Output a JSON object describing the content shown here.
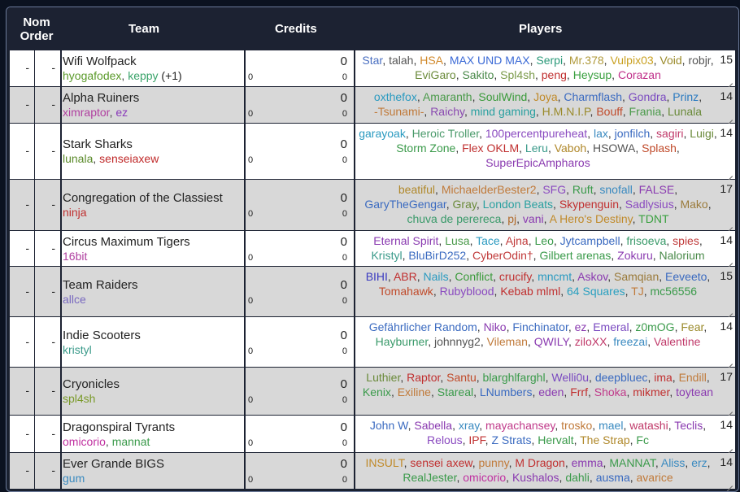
{
  "headers": {
    "nom_order": "Nom Order",
    "team": "Team",
    "credits": "Credits",
    "players": "Players"
  },
  "colors": {
    "header_bg": "#1c2232",
    "row_light": "#ffffff",
    "row_dark": "#d8d8d8"
  },
  "rows": [
    {
      "nom": "-",
      "order": "-",
      "team": "Wifi Wolfpack",
      "members": [
        {
          "t": "hyogafodex",
          "c": "#5a9a2a"
        },
        {
          "t": ", ",
          "c": "#444"
        },
        {
          "t": "keppy",
          "c": "#3aa36a"
        },
        {
          "t": " (+1)",
          "c": "#222"
        }
      ],
      "credits": "0",
      "credits_left": "0",
      "credits_right": "0",
      "count": "15",
      "players": [
        {
          "t": "Star",
          "c": "#4a6fc1"
        },
        {
          "t": "talah",
          "c": "#555"
        },
        {
          "t": "HSA",
          "c": "#d0882a"
        },
        {
          "t": "MAX UND MAX",
          "c": "#3b6ad6"
        },
        {
          "t": "Serpi",
          "c": "#2c9a7a"
        },
        {
          "t": "Mr.378",
          "c": "#b09a3c"
        },
        {
          "t": "Vulpix03",
          "c": "#c9a020"
        },
        {
          "t": "Void",
          "c": "#9a8a2a"
        },
        {
          "t": "robjr",
          "c": "#555"
        },
        {
          "t": "EviGaro",
          "c": "#6a8a3a"
        },
        {
          "t": "Sakito",
          "c": "#4a8a4a"
        },
        {
          "t": "Spl4sh",
          "c": "#7a9a4a"
        },
        {
          "t": "peng",
          "c": "#c03030"
        },
        {
          "t": "Heysup",
          "c": "#3aa040"
        },
        {
          "t": "Corazan",
          "c": "#c0308a"
        }
      ]
    },
    {
      "nom": "-",
      "order": "-",
      "team": "Alpha Ruiners",
      "members": [
        {
          "t": "ximraptor",
          "c": "#b040a0"
        },
        {
          "t": ", ",
          "c": "#444"
        },
        {
          "t": "ez",
          "c": "#8a3aba"
        }
      ],
      "credits": "0",
      "credits_left": "0",
      "credits_right": "0",
      "count": "14",
      "players": [
        {
          "t": "oxthefox",
          "c": "#2a9ac0"
        },
        {
          "t": "Amaranth",
          "c": "#4a9a4a"
        },
        {
          "t": "SoulWind",
          "c": "#3a9a3a"
        },
        {
          "t": "Joya",
          "c": "#c08a2a"
        },
        {
          "t": "Charmflash",
          "c": "#3a6ac0"
        },
        {
          "t": "Gondra",
          "c": "#7a4ac0"
        },
        {
          "t": "Prinz",
          "c": "#2a7ac0"
        },
        {
          "t": "-Tsunami-",
          "c": "#c07a3a"
        },
        {
          "t": "Raichy",
          "c": "#8a4ab0"
        },
        {
          "t": "mind gaming",
          "c": "#2aa0a0"
        },
        {
          "t": "H.M.N.I.P",
          "c": "#9a8a2a"
        },
        {
          "t": "Bouff",
          "c": "#c04a2a"
        },
        {
          "t": "Frania",
          "c": "#4a9a4a"
        },
        {
          "t": "Lunala",
          "c": "#6a8a3a"
        }
      ]
    },
    {
      "nom": "-",
      "order": "-",
      "team": "Stark Sharks",
      "members": [
        {
          "t": "lunala",
          "c": "#5a8a2a"
        },
        {
          "t": ", ",
          "c": "#444"
        },
        {
          "t": "senseiaxew",
          "c": "#c02a2a"
        }
      ],
      "credits": "0",
      "credits_left": "0",
      "credits_right": "0",
      "count": "14",
      "players": [
        {
          "t": "garayoak",
          "c": "#2a9ac0"
        },
        {
          "t": "Heroic Troller",
          "c": "#4a9a6a"
        },
        {
          "t": "100percentpureheat",
          "c": "#8a4ac0"
        },
        {
          "t": "lax",
          "c": "#3a8ac0"
        },
        {
          "t": "jonfilch",
          "c": "#3a6ac0"
        },
        {
          "t": "sagiri",
          "c": "#c03a6a"
        },
        {
          "t": "Luigi",
          "c": "#6a8a3a"
        },
        {
          "t": "Storm Zone",
          "c": "#3a9a4a"
        },
        {
          "t": "Flex OKLM",
          "c": "#c03030"
        },
        {
          "t": "Leru",
          "c": "#3a9a8a"
        },
        {
          "t": "Vaboh",
          "c": "#b0882a"
        },
        {
          "t": "HSOWA",
          "c": "#555"
        },
        {
          "t": "Splash",
          "c": "#c04a2a"
        },
        {
          "t": "SuperEpicAmpharos",
          "c": "#8a3ab0"
        }
      ]
    },
    {
      "nom": "-",
      "order": "-",
      "team": "Congregation of the Classiest",
      "members": [
        {
          "t": "ninja",
          "c": "#c03030"
        }
      ],
      "credits": "0",
      "credits_left": "0",
      "credits_right": "0",
      "count": "17",
      "players": [
        {
          "t": "beatiful",
          "c": "#b0882a"
        },
        {
          "t": "MichaelderBester2",
          "c": "#c07a3a"
        },
        {
          "t": "SFG",
          "c": "#8a4ac0"
        },
        {
          "t": "Ruft",
          "c": "#3a9a4a"
        },
        {
          "t": "snofall",
          "c": "#3a8ac0"
        },
        {
          "t": "FALSE",
          "c": "#8a3ab0"
        },
        {
          "t": "GaryTheGengar",
          "c": "#3a6ac0"
        },
        {
          "t": "Gray",
          "c": "#6a8a3a"
        },
        {
          "t": "London Beats",
          "c": "#2aa0a0"
        },
        {
          "t": "Skypenguin",
          "c": "#c03030"
        },
        {
          "t": "Sadlysius",
          "c": "#8a4ac0"
        },
        {
          "t": "Mako",
          "c": "#9a7a3a"
        },
        {
          "t": "chuva de perereca",
          "c": "#3a9a6a"
        },
        {
          "t": "pj",
          "c": "#b06a2a"
        },
        {
          "t": "vani",
          "c": "#8a3ab0"
        },
        {
          "t": "A Hero's Destiny",
          "c": "#c08a2a"
        },
        {
          "t": "TDNT",
          "c": "#3aa040"
        }
      ]
    },
    {
      "nom": "-",
      "order": "-",
      "team": "Circus Maximum Tigers",
      "members": [
        {
          "t": "16bit",
          "c": "#b040a0"
        }
      ],
      "credits": "0",
      "credits_left": "0",
      "credits_right": "0",
      "count": "14",
      "players": [
        {
          "t": "Eternal Spirit",
          "c": "#8a3ab0"
        },
        {
          "t": "Lusa",
          "c": "#4a9a4a"
        },
        {
          "t": "Tace",
          "c": "#2a9ac0"
        },
        {
          "t": "Ajna",
          "c": "#c03a3a"
        },
        {
          "t": "Leo",
          "c": "#3a9a4a"
        },
        {
          "t": "Jytcampbell",
          "c": "#3a6ac0"
        },
        {
          "t": "frisoeva",
          "c": "#3a9a6a"
        },
        {
          "t": "spies",
          "c": "#c03a3a"
        },
        {
          "t": "Kristyl",
          "c": "#3a9a8a"
        },
        {
          "t": "BluBirD252",
          "c": "#3a6ac0"
        },
        {
          "t": "CyberOdin†",
          "c": "#c03a3a"
        },
        {
          "t": "Gilbert arenas",
          "c": "#3a9a4a"
        },
        {
          "t": "Zokuru",
          "c": "#8a3ab0"
        },
        {
          "t": "Nalorium",
          "c": "#4a8a4a"
        }
      ]
    },
    {
      "nom": "-",
      "order": "-",
      "team": "Team Raiders",
      "members": [
        {
          "t": "allce",
          "c": "#7a6ac0"
        }
      ],
      "credits": "0",
      "credits_left": "0",
      "credits_right": "0",
      "count": "15",
      "players": [
        {
          "t": "BIHI",
          "c": "#3a3ac0"
        },
        {
          "t": "ABR",
          "c": "#c03030"
        },
        {
          "t": "Nails",
          "c": "#2a9ac0"
        },
        {
          "t": "Conflict",
          "c": "#3a9a3a"
        },
        {
          "t": "crucify",
          "c": "#c03030"
        },
        {
          "t": "mncmt",
          "c": "#2a9ac0"
        },
        {
          "t": "Askov",
          "c": "#8a3ab0"
        },
        {
          "t": "Samqian",
          "c": "#9a7a3a"
        },
        {
          "t": "Eeveeto",
          "c": "#3a6ac0"
        },
        {
          "t": "Tomahawk",
          "c": "#c04a2a"
        },
        {
          "t": "Rubyblood",
          "c": "#8a4ac0"
        },
        {
          "t": "Kebab mlml",
          "c": "#c03030"
        },
        {
          "t": "64 Squares",
          "c": "#2aa0c0"
        },
        {
          "t": "TJ",
          "c": "#c07a3a"
        },
        {
          "t": "mc56556",
          "c": "#3a9a4a"
        }
      ]
    },
    {
      "nom": "-",
      "order": "-",
      "team": "Indie Scooters",
      "members": [
        {
          "t": "kristyl",
          "c": "#3a9a8a"
        }
      ],
      "credits": "0",
      "credits_left": "0",
      "credits_right": "0",
      "count": "14",
      "players": [
        {
          "t": "Gefährlicher Random",
          "c": "#3a6ac0"
        },
        {
          "t": "Niko",
          "c": "#8a3ab0"
        },
        {
          "t": "Finchinator",
          "c": "#3a6ac0"
        },
        {
          "t": "ez",
          "c": "#8a3ab0"
        },
        {
          "t": "Emeral",
          "c": "#7a4ac0"
        },
        {
          "t": "z0mOG",
          "c": "#3a9a4a"
        },
        {
          "t": "Fear",
          "c": "#9a8a2a"
        },
        {
          "t": "Hayburner",
          "c": "#3a9a6a"
        },
        {
          "t": "johnnyg2",
          "c": "#555"
        },
        {
          "t": "Vileman",
          "c": "#c07a3a"
        },
        {
          "t": "QWILY",
          "c": "#8a3ab0"
        },
        {
          "t": "ziloXX",
          "c": "#c03a6a"
        },
        {
          "t": "freezai",
          "c": "#3a8ac0"
        },
        {
          "t": "Valentine",
          "c": "#c03a6a"
        }
      ]
    },
    {
      "nom": "-",
      "order": "-",
      "team": "Cryonicles",
      "members": [
        {
          "t": "spl4sh",
          "c": "#7a9a2a"
        }
      ],
      "credits": "0",
      "credits_left": "0",
      "credits_right": "0",
      "count": "17",
      "players": [
        {
          "t": "Luthier",
          "c": "#6a8a3a"
        },
        {
          "t": "Raptor",
          "c": "#c03030"
        },
        {
          "t": "Santu",
          "c": "#c04a2a"
        },
        {
          "t": "blarghlfarghl",
          "c": "#3a9a4a"
        },
        {
          "t": "Welli0u",
          "c": "#7a4ac0"
        },
        {
          "t": "deepbluec",
          "c": "#3a6ac0"
        },
        {
          "t": "ima",
          "c": "#c03030"
        },
        {
          "t": "Endill",
          "c": "#c07a3a"
        },
        {
          "t": "Kenix",
          "c": "#3a9a4a"
        },
        {
          "t": "Exiline",
          "c": "#c07a3a"
        },
        {
          "t": "Stareal",
          "c": "#3a9a4a"
        },
        {
          "t": "LNumbers",
          "c": "#3a6ac0"
        },
        {
          "t": "eden",
          "c": "#8a3ab0"
        },
        {
          "t": "Frrf",
          "c": "#c03030"
        },
        {
          "t": "Shoka",
          "c": "#c03a8a"
        },
        {
          "t": "mikmer",
          "c": "#c03030"
        },
        {
          "t": "toytean",
          "c": "#8a3ab0"
        }
      ]
    },
    {
      "nom": "-",
      "order": "-",
      "team": "Dragonspiral Tyrants",
      "members": [
        {
          "t": "omicorio",
          "c": "#c030a0"
        },
        {
          "t": ", ",
          "c": "#444"
        },
        {
          "t": "mannat",
          "c": "#3a9a4a"
        }
      ],
      "credits": "0",
      "credits_left": "0",
      "credits_right": "0",
      "count": "14",
      "players": [
        {
          "t": "John W",
          "c": "#3a6ac0"
        },
        {
          "t": "Sabella",
          "c": "#8a3ab0"
        },
        {
          "t": "xray",
          "c": "#3a8ac0"
        },
        {
          "t": "mayachansey",
          "c": "#c03a8a"
        },
        {
          "t": "trosko",
          "c": "#c07a3a"
        },
        {
          "t": "mael",
          "c": "#3a8ac0"
        },
        {
          "t": "watashi",
          "c": "#c03a6a"
        },
        {
          "t": "Teclis",
          "c": "#8a3ab0"
        },
        {
          "t": "Relous",
          "c": "#8a4ac0"
        },
        {
          "t": "IPF",
          "c": "#c03030"
        },
        {
          "t": "Z Strats",
          "c": "#3a6ac0"
        },
        {
          "t": "Hervalt",
          "c": "#3a9a4a"
        },
        {
          "t": "The Strap",
          "c": "#b0882a"
        },
        {
          "t": "Fc",
          "c": "#3a9a4a"
        }
      ]
    },
    {
      "nom": "-",
      "order": "-",
      "team": "Ever Grande BIGS",
      "members": [
        {
          "t": "gum",
          "c": "#3a8ac0"
        }
      ],
      "credits": "0",
      "credits_left": "0",
      "credits_right": "0",
      "count": "14",
      "players": [
        {
          "t": "INSULT",
          "c": "#c08a2a"
        },
        {
          "t": "sensei axew",
          "c": "#c03030"
        },
        {
          "t": "punny",
          "c": "#c07a3a"
        },
        {
          "t": "M Dragon",
          "c": "#c03030"
        },
        {
          "t": "emma",
          "c": "#8a3ab0"
        },
        {
          "t": "MANNAT",
          "c": "#3a9a4a"
        },
        {
          "t": "Aliss",
          "c": "#3a8ac0"
        },
        {
          "t": "erz",
          "c": "#3a8ac0"
        },
        {
          "t": "RealJester",
          "c": "#3a9a4a"
        },
        {
          "t": "omicorio",
          "c": "#c030a0"
        },
        {
          "t": "Kushalos",
          "c": "#8a3ab0"
        },
        {
          "t": "dahli",
          "c": "#3a9a4a"
        },
        {
          "t": "ausma",
          "c": "#3a6ac0"
        },
        {
          "t": "avarice",
          "c": "#c07a3a"
        }
      ]
    }
  ]
}
